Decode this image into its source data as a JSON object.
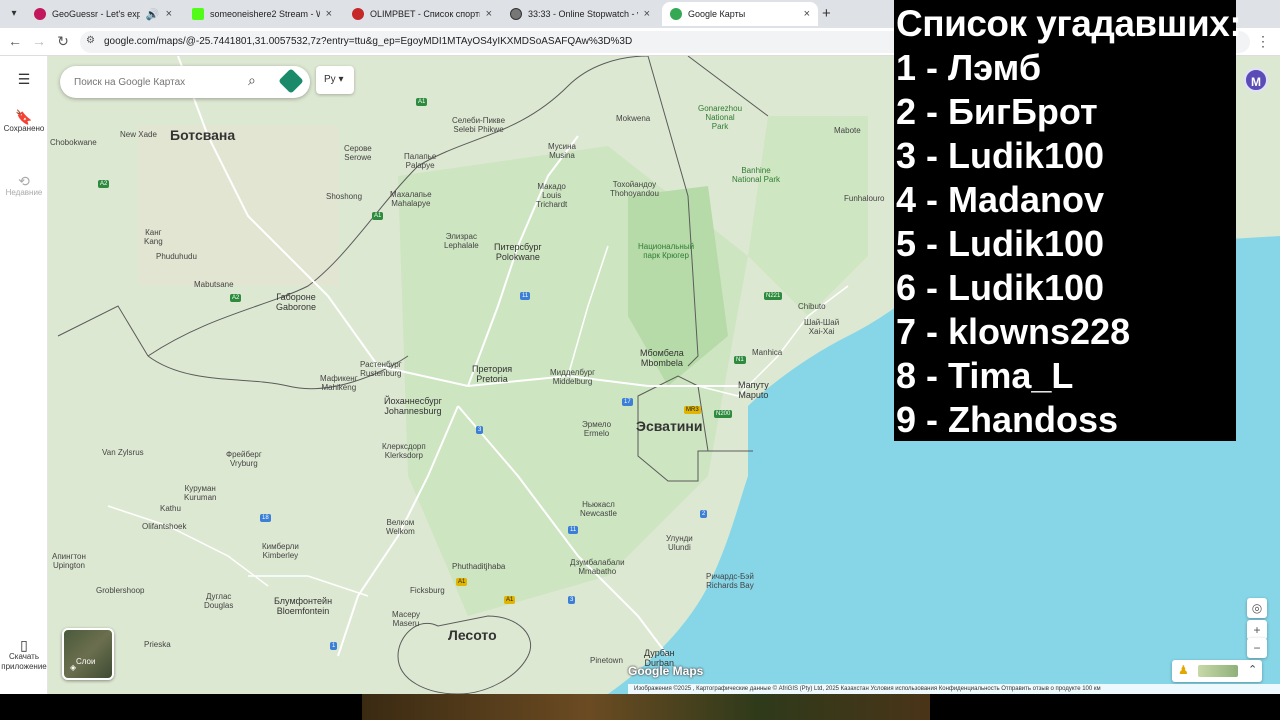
{
  "browser": {
    "tabs": [
      {
        "title": "GeoGuessr - Let's explore th",
        "color": "#c2185b"
      },
      {
        "title": "someoneishere2 Stream - Watc",
        "color": "#53fc18"
      },
      {
        "title": "OLIMPBET - Список спортивн",
        "color": "#c62828"
      },
      {
        "title": "33:33 - Online Stopwatch - vCl",
        "color": "#777777"
      },
      {
        "title": "Google Карты",
        "color": "#34a853"
      }
    ],
    "url": "google.com/maps/@-25.7441801,31.0057532,7z?entry=ttu&g_ep=EgoyMDI1MTAyOS4yIKXMDSoASAFQAw%3D%3D"
  },
  "rail": {
    "saved": "Сохранено",
    "recent": "Недавние",
    "download": "Скачать приложение"
  },
  "search": {
    "placeholder": "Поиск на Google Картах"
  },
  "lang_button": "Ру",
  "layers_label": "Слои",
  "avatar_letter": "M",
  "logo_text": "Google Maps",
  "footer": "Изображения ©2025 , Картографические данные © AfriGIS (Pty) Ltd, 2025    Казахстан    Условия использования    Конфиденциальность    Отправить отзыв о продукте    100 км",
  "map_labels": {
    "botswana": "Ботсвана",
    "eswatini": "Эсватини",
    "lesotho": "Лесото",
    "gaborone": "Габороне\nGaborone",
    "pretoria": "Претория\nPretoria",
    "johannesburg": "Йоханнесбург\nJohannesburg",
    "maputo": "Мапуту\nMaputo",
    "polokwane": "Питерсбург\nPolokwane",
    "bloemfontein": "Блумфонтейн\nBloemfontein",
    "mbombela": "Мбомбела\nMbombela",
    "rustenburg": "Растенбург\nRustenburg",
    "kimberley": "Кимберли\nKimberley",
    "durban": "Дурбан\nDurban",
    "newcastle": "Ньюкасл\nNewcastle",
    "welkom": "Велком\nWelkom",
    "klerksdorp": "Клерксдорп\nKlerksdorp",
    "mahikeng": "Мафикенг\nMahikeng",
    "vryburg": "Фрейберг\nVryburg",
    "kruger": "Национальный\nпарк Крюгер",
    "banhine": "Banhine\nNational Park",
    "gonarezhou": "Gonarezhou\nNational\nPark",
    "mokopane": "Макадо\nLouis\nTrichardt",
    "tzaneen": "Тохойандоу\nThohoyandou",
    "lephalale": "Элизрас\nLephalale",
    "middelburg": "Мидделбург\nMiddelburg",
    "ermelo": "Эрмело\nErmelo",
    "xai_xai": "Шай-Шай\nXai-Xai",
    "chibuto": "Chibuto",
    "manhica": "Manhica",
    "serowe": "Серове\nSerowe",
    "palapye": "Палапье\nPalapye",
    "shoshong": "Shoshong",
    "mahalapye": "Махалапье\nMahalapye",
    "mabutsane": "Mabutsane",
    "kang": "Канг\nKang",
    "mokopane2": "Мусина\nMusina",
    "new_xade": "New Xade",
    "selebi": "Селеби-Пикве\nSelebi Phikwe",
    "fourth": "Phuduhudu",
    "chobokwane": "Chobokwane",
    "van_zylsrus": "Van Zylsrus",
    "kuruman": "Куруман\nKuruman",
    "kathu": "Kathu",
    "olifantshoek": "Olifantshoek",
    "upington": "Апингтон\nUpington",
    "groblershoop": "Groblershoop",
    "douglas": "Дуглас\nDouglas",
    "prieska": "Prieska",
    "maseru": "Масеру\nMaseru",
    "ficksburg": "Ficksburg",
    "mbombo": "Phuthaditjhaba",
    "ulundi": "Улунди\nUlundi",
    "richards_bay": "Ричардс-Бэй\nRichards Bay",
    "pinetown": "Pinetown",
    "mabote": "Mabote",
    "funhalouro": "Funhalouro",
    "mokwena": "Mokwena",
    "sikhu": "Дзумбалабали\nMmabatho"
  },
  "overlay": {
    "heading": "Список угадавших:",
    "items": [
      "1 - Лэмб",
      "2 - БигБрот",
      "3 - Ludik100",
      "4 - Madanov",
      "5 - Ludik100",
      "6 - Ludik100",
      "7 - klowns228",
      "8 - Tima_L",
      "9 - Zhandoss"
    ]
  },
  "colors": {
    "land": "#dde8d2",
    "forest": "#bfe0b4",
    "sea": "#86d6e8",
    "road": "#ffffff",
    "border": "#5b5b5b"
  }
}
